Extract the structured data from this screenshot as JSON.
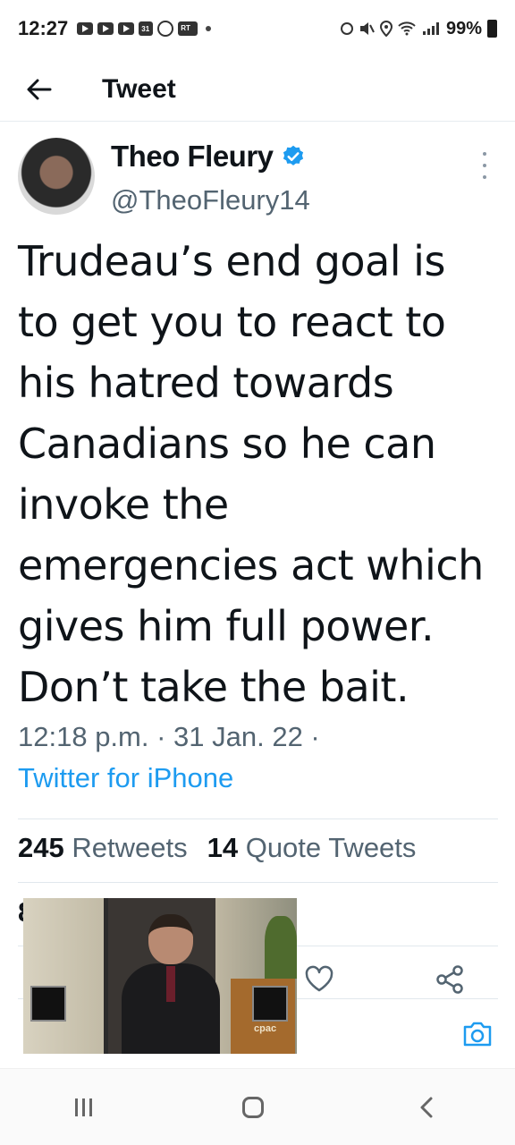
{
  "status_bar": {
    "time": "12:27",
    "calendar_day": "31",
    "rt_label": "RT",
    "battery": "99%"
  },
  "header": {
    "title": "Tweet"
  },
  "tweet": {
    "author_name": "Theo Fleury",
    "author_handle": "@TheoFleury14",
    "verified": true,
    "text": "Trudeau’s end goal is to get you to react to his hatred towards Canadians so he can invoke the emergencies act which gives him full power. Don’t take the bait.",
    "text_lines": [
      "Trudeau’s end goal is",
      "to get you to react to",
      "his hatred towards",
      "Canadians so he can",
      "invoke the",
      "emergencies act which",
      "gives him full power.",
      "Don’t take the bait."
    ],
    "timestamp": "12:18 p.m. · 31 Jan. 22 ·",
    "source": "Twitter for iPhone",
    "retweets_count": "245",
    "retweets_label": "Retweets",
    "quotes_count": "14",
    "quotes_label": "Quote Tweets",
    "likes_count_partial": "8"
  },
  "video_overlay": {
    "watermark": "cpac"
  },
  "icons": {
    "back": "arrow-left-icon",
    "verified": "verified-badge-icon",
    "more": "more-vertical-icon",
    "like": "heart-icon",
    "share": "share-icon",
    "camera": "camera-icon"
  },
  "colors": {
    "accent": "#1d9bf0",
    "secondary_text": "#536471",
    "primary_text": "#0f1419"
  }
}
